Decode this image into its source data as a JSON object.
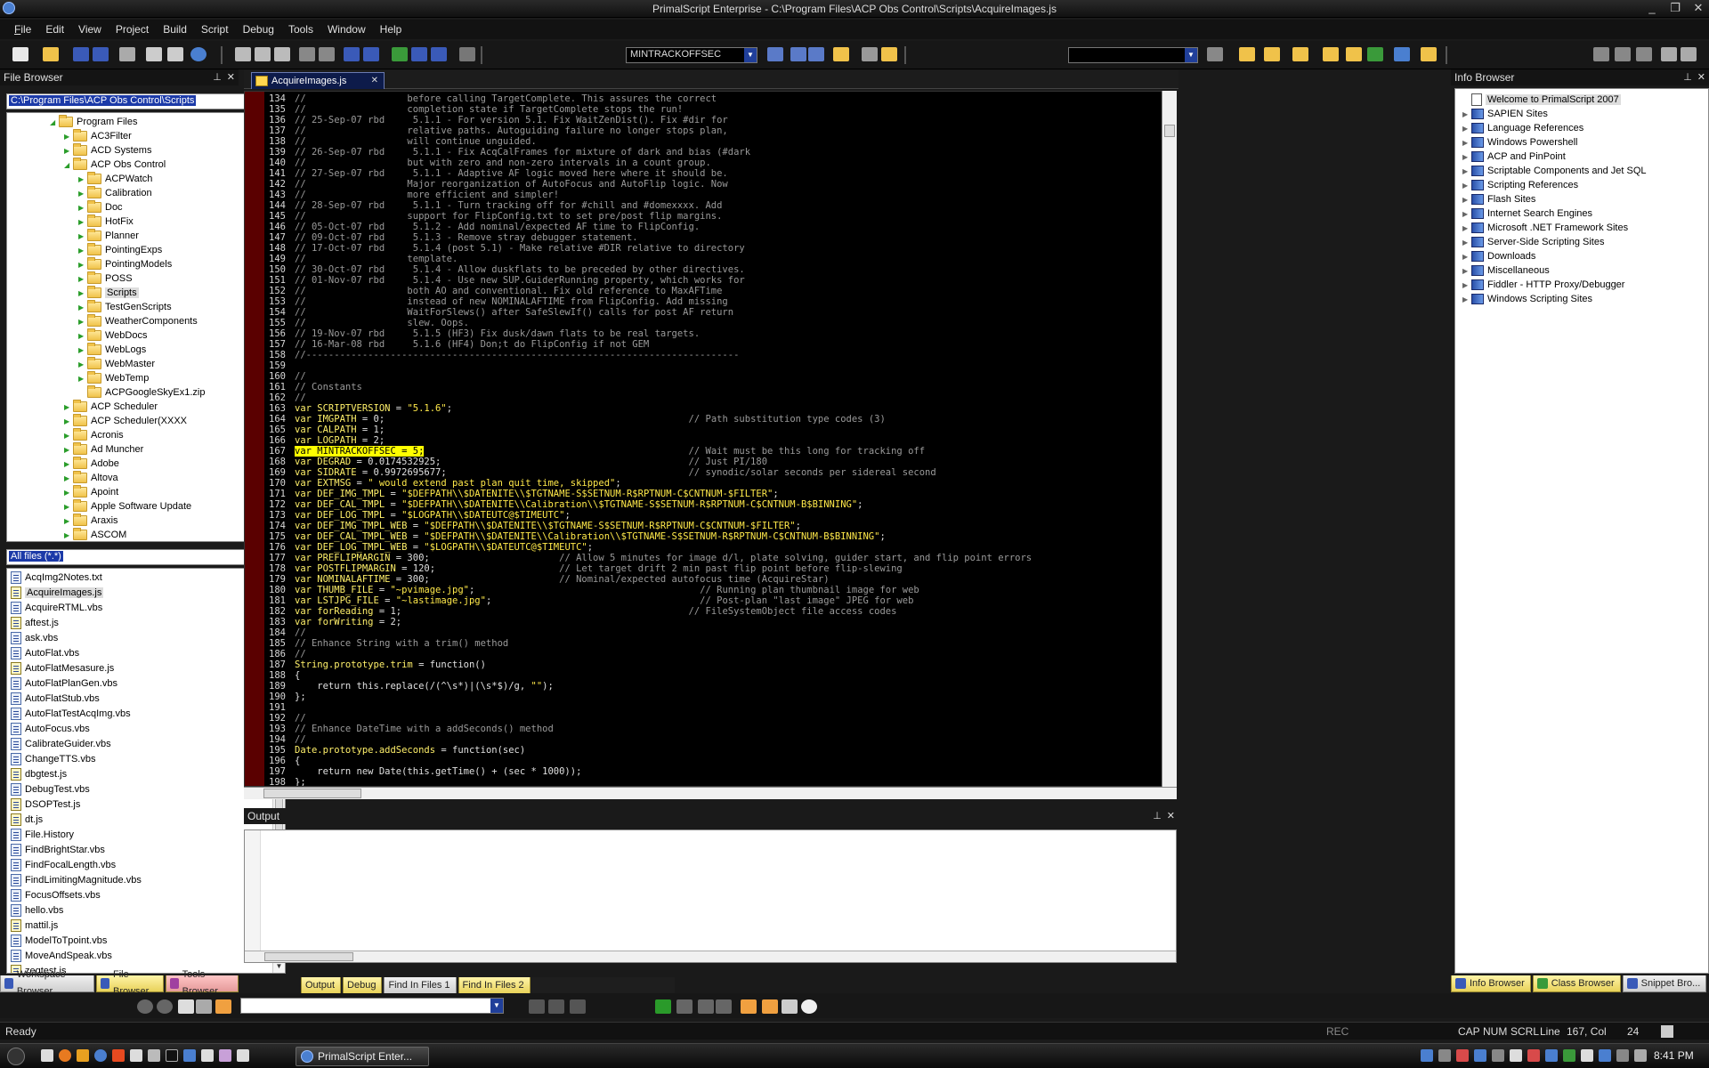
{
  "window": {
    "title": "PrimalScript Enterprise - C:\\Program Files\\ACP Obs Control\\Scripts\\AcquireImages.js",
    "controls": [
      "_",
      "❐",
      "✕"
    ]
  },
  "menu": [
    "File",
    "Edit",
    "View",
    "Project",
    "Build",
    "Script",
    "Debug",
    "Tools",
    "Window",
    "Help"
  ],
  "toolbar": {
    "symbol_combo": "MINTRACKOFFSEC",
    "search_combo": ""
  },
  "file_browser": {
    "title": "File Browser",
    "path": "C:\\Program Files\\ACP Obs Control\\Scripts",
    "tree": [
      {
        "label": "Program Files",
        "level": 0
      },
      {
        "label": "AC3Filter",
        "level": 1
      },
      {
        "label": "ACD Systems",
        "level": 1
      },
      {
        "label": "ACP Obs Control",
        "level": 1
      },
      {
        "label": "ACPWatch",
        "level": 2
      },
      {
        "label": "Calibration",
        "level": 2
      },
      {
        "label": "Doc",
        "level": 2
      },
      {
        "label": "HotFix",
        "level": 2
      },
      {
        "label": "Planner",
        "level": 2
      },
      {
        "label": "PointingExps",
        "level": 2
      },
      {
        "label": "PointingModels",
        "level": 2
      },
      {
        "label": "POSS",
        "level": 2
      },
      {
        "label": "Scripts",
        "level": 2
      },
      {
        "label": "TestGenScripts",
        "level": 2
      },
      {
        "label": "WeatherComponents",
        "level": 2
      },
      {
        "label": "WebDocs",
        "level": 2
      },
      {
        "label": "WebLogs",
        "level": 2
      },
      {
        "label": "WebMaster",
        "level": 2
      },
      {
        "label": "WebTemp",
        "level": 2
      },
      {
        "label": "ACPGoogleSkyEx1.zip",
        "level": 2
      },
      {
        "label": "ACP Scheduler",
        "level": 1
      },
      {
        "label": "ACP Scheduler(XXXX",
        "level": 1
      },
      {
        "label": "Acronis",
        "level": 1
      },
      {
        "label": "Ad Muncher",
        "level": 1
      },
      {
        "label": "Adobe",
        "level": 1
      },
      {
        "label": "Altova",
        "level": 1
      },
      {
        "label": "Apoint",
        "level": 1
      },
      {
        "label": "Apple Software Update",
        "level": 1
      },
      {
        "label": "Araxis",
        "level": 1
      },
      {
        "label": "ASCOM",
        "level": 1
      }
    ],
    "filter": "All files (*.*)",
    "files": [
      "AcqImg2Notes.txt",
      "AcquireImages.js",
      "AcquireRTML.vbs",
      "aftest.js",
      "ask.vbs",
      "AutoFlat.vbs",
      "AutoFlatMesasure.js",
      "AutoFlatPlanGen.vbs",
      "AutoFlatStub.vbs",
      "AutoFlatTestAcqImg.vbs",
      "AutoFocus.vbs",
      "CalibrateGuider.vbs",
      "ChangeTTS.vbs",
      "dbgtest.js",
      "DebugTest.vbs",
      "DSOPTest.js",
      "dt.js",
      "File.History",
      "FindBrightStar.vbs",
      "FindFocalLength.vbs",
      "FindLimitingMagnitude.vbs",
      "FocusOffsets.vbs",
      "hello.vbs",
      "mattil.js",
      "ModelToTpoint.vbs",
      "MoveAndSpeak.vbs",
      "zeqtest.js"
    ],
    "bottom_tabs": [
      "Workspace Browser",
      "File Browser",
      "Tools Browser"
    ]
  },
  "editor": {
    "tab_label": "AcquireImages.js",
    "lines": [
      {
        "n": "134",
        "t": "//                  before calling TargetComplete. This assures the correct"
      },
      {
        "n": "135",
        "t": "//                  completion state if TargetComplete stops the run!"
      },
      {
        "n": "136",
        "t": "// 25-Sep-07 rbd     5.1.1 - For version 5.1. Fix WaitZenDist(). Fix #dir for"
      },
      {
        "n": "137",
        "t": "//                  relative paths. Autoguiding failure no longer stops plan,"
      },
      {
        "n": "138",
        "t": "//                  will continue unguided."
      },
      {
        "n": "139",
        "t": "// 26-Sep-07 rbd     5.1.1 - Fix AcqCalFrames for mixture of dark and bias (#dark"
      },
      {
        "n": "140",
        "t": "//                  but with zero and non-zero intervals in a count group."
      },
      {
        "n": "141",
        "t": "// 27-Sep-07 rbd     5.1.1 - Adaptive AF logic moved here where it should be."
      },
      {
        "n": "142",
        "t": "//                  Major reorganization of AutoFocus and AutoFlip logic. Now"
      },
      {
        "n": "143",
        "t": "//                  more efficient and simpler!"
      },
      {
        "n": "144",
        "t": "// 28-Sep-07 rbd     5.1.1 - Turn tracking off for #chill and #domexxxx. Add"
      },
      {
        "n": "145",
        "t": "//                  support for FlipConfig.txt to set pre/post flip margins."
      },
      {
        "n": "146",
        "t": "// 05-Oct-07 rbd     5.1.2 - Add nominal/expected AF time to FlipConfig."
      },
      {
        "n": "147",
        "t": "// 09-Oct-07 rbd     5.1.3 - Remove stray debugger statement."
      },
      {
        "n": "148",
        "t": "// 17-Oct-07 rbd     5.1.4 (post 5.1) - Make relative #DIR relative to directory"
      },
      {
        "n": "149",
        "t": "//                  template."
      },
      {
        "n": "150",
        "t": "// 30-Oct-07 rbd     5.1.4 - Allow duskflats to be preceded by other directives."
      },
      {
        "n": "151",
        "t": "// 01-Nov-07 rbd     5.1.4 - Use new SUP.GuiderRunning property, which works for"
      },
      {
        "n": "152",
        "t": "//                  both AO and conventional. Fix old reference to MaxAFTime"
      },
      {
        "n": "153",
        "t": "//                  instead of new NOMINALAFTIME from FlipConfig. Add missing"
      },
      {
        "n": "154",
        "t": "//                  WaitForSlews() after SafeSlewIf() calls for post AF return"
      },
      {
        "n": "155",
        "t": "//                  slew. Oops."
      },
      {
        "n": "156",
        "t": "// 19-Nov-07 rbd     5.1.5 (HF3) Fix dusk/dawn flats to be real targets."
      },
      {
        "n": "157",
        "t": "// 16-Mar-08 rbd     5.1.6 (HF4) Don;t do FlipConfig if not GEM"
      },
      {
        "n": "158",
        "t": "//-----------------------------------------------------------------------------"
      },
      {
        "n": "159",
        "t": ""
      },
      {
        "n": "160",
        "t": "//"
      },
      {
        "n": "161",
        "t": "// Constants"
      },
      {
        "n": "162",
        "t": "//"
      },
      {
        "n": "163",
        "t": "var SCRIPTVERSION = \"5.1.6\";"
      },
      {
        "n": "164",
        "t": "var IMGPATH = 0;                                                      // Path substitution type codes (3)"
      },
      {
        "n": "165",
        "t": "var CALPATH = 1;"
      },
      {
        "n": "166",
        "t": "var LOGPATH = 2;"
      },
      {
        "n": "167",
        "t": "var MINTRACKOFFSEC = 5;                                               // Wait must be this long for tracking off"
      },
      {
        "n": "168",
        "t": "var DEGRAD = 0.0174532925;                                            // Just PI/180"
      },
      {
        "n": "169",
        "t": "var SIDRATE = 0.9972695677;                                           // synodic/solar seconds per sidereal second"
      },
      {
        "n": "170",
        "t": "var EXTMSG = \" would extend past plan quit time, skipped\";"
      },
      {
        "n": "171",
        "t": "var DEF_IMG_TMPL = \"$DEFPATH\\\\$DATENITE\\\\$TGTNAME-S$SETNUM-R$RPTNUM-C$CNTNUM-$FILTER\";"
      },
      {
        "n": "172",
        "t": "var DEF_CAL_TMPL = \"$DEFPATH\\\\$DATENITE\\\\Calibration\\\\$TGTNAME-S$SETNUM-R$RPTNUM-C$CNTNUM-B$BINNING\";"
      },
      {
        "n": "173",
        "t": "var DEF_LOG_TMPL = \"$LOGPATH\\\\$DATEUTC@$TIMEUTC\";"
      },
      {
        "n": "174",
        "t": "var DEF_IMG_TMPL_WEB = \"$DEFPATH\\\\$DATENITE\\\\$TGTNAME-S$SETNUM-R$RPTNUM-C$CNTNUM-$FILTER\";"
      },
      {
        "n": "175",
        "t": "var DEF_CAL_TMPL_WEB = \"$DEFPATH\\\\$DATENITE\\\\Calibration\\\\$TGTNAME-S$SETNUM-R$RPTNUM-C$CNTNUM-B$BINNING\";"
      },
      {
        "n": "176",
        "t": "var DEF_LOG_TMPL_WEB = \"$LOGPATH\\\\$DATEUTC@$TIMEUTC\";"
      },
      {
        "n": "177",
        "t": "var PREFLIPMARGIN = 300;                       // Allow 5 minutes for image d/l, plate solving, guider start, and flip point errors"
      },
      {
        "n": "178",
        "t": "var POSTFLIPMARGIN = 120;                      // Let target drift 2 min past flip point before flip-slewing"
      },
      {
        "n": "179",
        "t": "var NOMINALAFTIME = 300;                       // Nominal/expected autofocus time (AcquireStar)"
      },
      {
        "n": "180",
        "t": "var THUMB_FILE = \"~pvimage.jpg\";                                        // Running plan thumbnail image for web"
      },
      {
        "n": "181",
        "t": "var LSTJPG_FILE = \"~lastimage.jpg\";                                     // Post-plan \"last image\" JPEG for web"
      },
      {
        "n": "182",
        "t": "var forReading = 1;                                                   // FileSystemObject file access codes"
      },
      {
        "n": "183",
        "t": "var forWriting = 2;"
      },
      {
        "n": "184",
        "t": "//"
      },
      {
        "n": "185",
        "t": "// Enhance String with a trim() method"
      },
      {
        "n": "186",
        "t": "//"
      },
      {
        "n": "187",
        "t": "String.prototype.trim = function()"
      },
      {
        "n": "188",
        "t": "{"
      },
      {
        "n": "189",
        "t": "    return this.replace(/(^\\s*)|(\\s*$)/g, \"\");"
      },
      {
        "n": "190",
        "t": "};"
      },
      {
        "n": "191",
        "t": ""
      },
      {
        "n": "192",
        "t": "//"
      },
      {
        "n": "193",
        "t": "// Enhance DateTime with a addSeconds() method"
      },
      {
        "n": "194",
        "t": "//"
      },
      {
        "n": "195",
        "t": "Date.prototype.addSeconds = function(sec)"
      },
      {
        "n": "196",
        "t": "{"
      },
      {
        "n": "197",
        "t": "    return new Date(this.getTime() + (sec * 1000));"
      },
      {
        "n": "198",
        "t": "};"
      }
    ],
    "highlight": "var MINTRACKOFFSEC = 5;"
  },
  "output": {
    "title": "Output",
    "tabs": [
      "Output",
      "Debug",
      "Find In Files 1",
      "Find In Files 2"
    ]
  },
  "info_browser": {
    "title": "Info Browser",
    "items": [
      "Welcome to PrimalScript 2007",
      "SAPIEN Sites",
      "Language References",
      "Windows Powershell",
      "ACP and PinPoint",
      "Scriptable Components and Jet SQL",
      "Scripting References",
      "Flash Sites",
      "Internet Search Engines",
      "Microsoft .NET Framework Sites",
      "Server-Side Scripting Sites",
      "Downloads",
      "Miscellaneous",
      "Fiddler - HTTP Proxy/Debugger",
      "Windows Scripting Sites"
    ],
    "bottom_tabs": [
      "Info Browser",
      "Class Browser",
      "Snippet Bro..."
    ]
  },
  "status": {
    "text": "Ready",
    "rec": "REC",
    "cap": "CAP",
    "num": "NUM",
    "scrl": "SCRL",
    "line_label": "Line",
    "position": "167, Col",
    "col": "24"
  },
  "taskbar": {
    "task_label": "PrimalScript Enter...",
    "clock": "8:41 PM"
  }
}
